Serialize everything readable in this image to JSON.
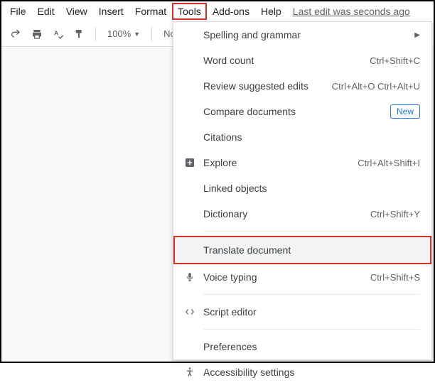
{
  "menubar": {
    "items": [
      "File",
      "Edit",
      "View",
      "Insert",
      "Format",
      "Tools",
      "Add-ons",
      "Help"
    ],
    "last_edit": "Last edit was seconds ago"
  },
  "toolbar": {
    "zoom": "100%",
    "style": "Normal"
  },
  "dropdown": {
    "items": [
      {
        "label": "Spelling and grammar",
        "accel": "",
        "submenu": true
      },
      {
        "label": "Word count",
        "accel": "Ctrl+Shift+C"
      },
      {
        "label": "Review suggested edits",
        "accel": "Ctrl+Alt+O Ctrl+Alt+U"
      },
      {
        "label": "Compare documents",
        "new": true
      },
      {
        "label": "Citations"
      },
      {
        "label": "Explore",
        "accel": "Ctrl+Alt+Shift+I",
        "icon": "explore"
      },
      {
        "label": "Linked objects"
      },
      {
        "label": "Dictionary",
        "accel": "Ctrl+Shift+Y"
      },
      {
        "label": "Translate document",
        "highlighted": true
      },
      {
        "label": "Voice typing",
        "accel": "Ctrl+Shift+S",
        "icon": "mic"
      },
      {
        "label": "Script editor",
        "icon": "script"
      },
      {
        "label": "Preferences"
      },
      {
        "label": "Accessibility settings",
        "icon": "accessibility"
      }
    ]
  }
}
